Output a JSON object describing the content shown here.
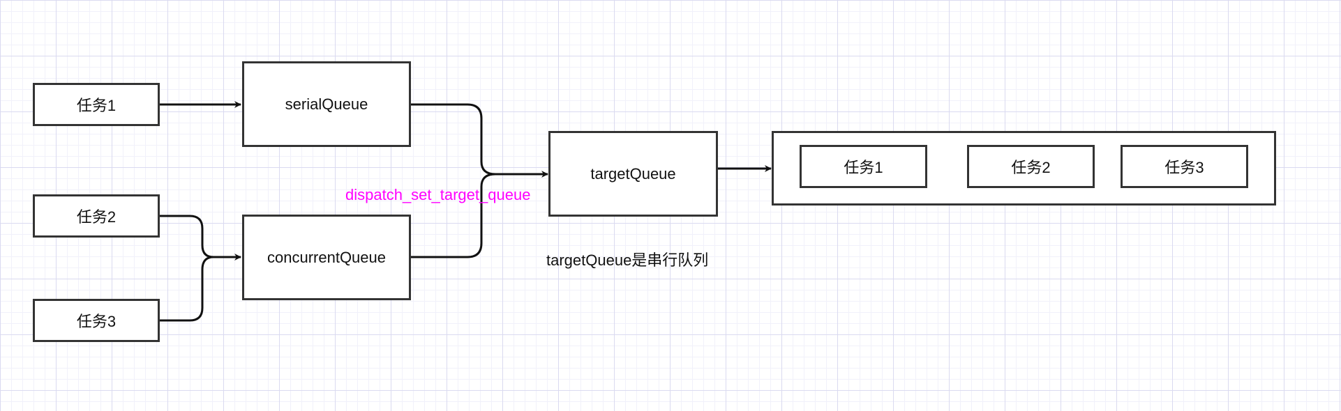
{
  "colors": {
    "stroke": "#333333",
    "arrow": "#111111",
    "annotation": "#ff00ff",
    "text": "#111111"
  },
  "tasks_left": {
    "task1": "任务1",
    "task2": "任务2",
    "task3": "任务3"
  },
  "queues": {
    "serial": "serialQueue",
    "concurrent": "concurrentQueue",
    "target": "targetQueue"
  },
  "annotation": "dispatch_set_target_queue",
  "note": "targetQueue是串行队列",
  "tasks_right": [
    "任务1",
    "任务2",
    "任务3"
  ]
}
